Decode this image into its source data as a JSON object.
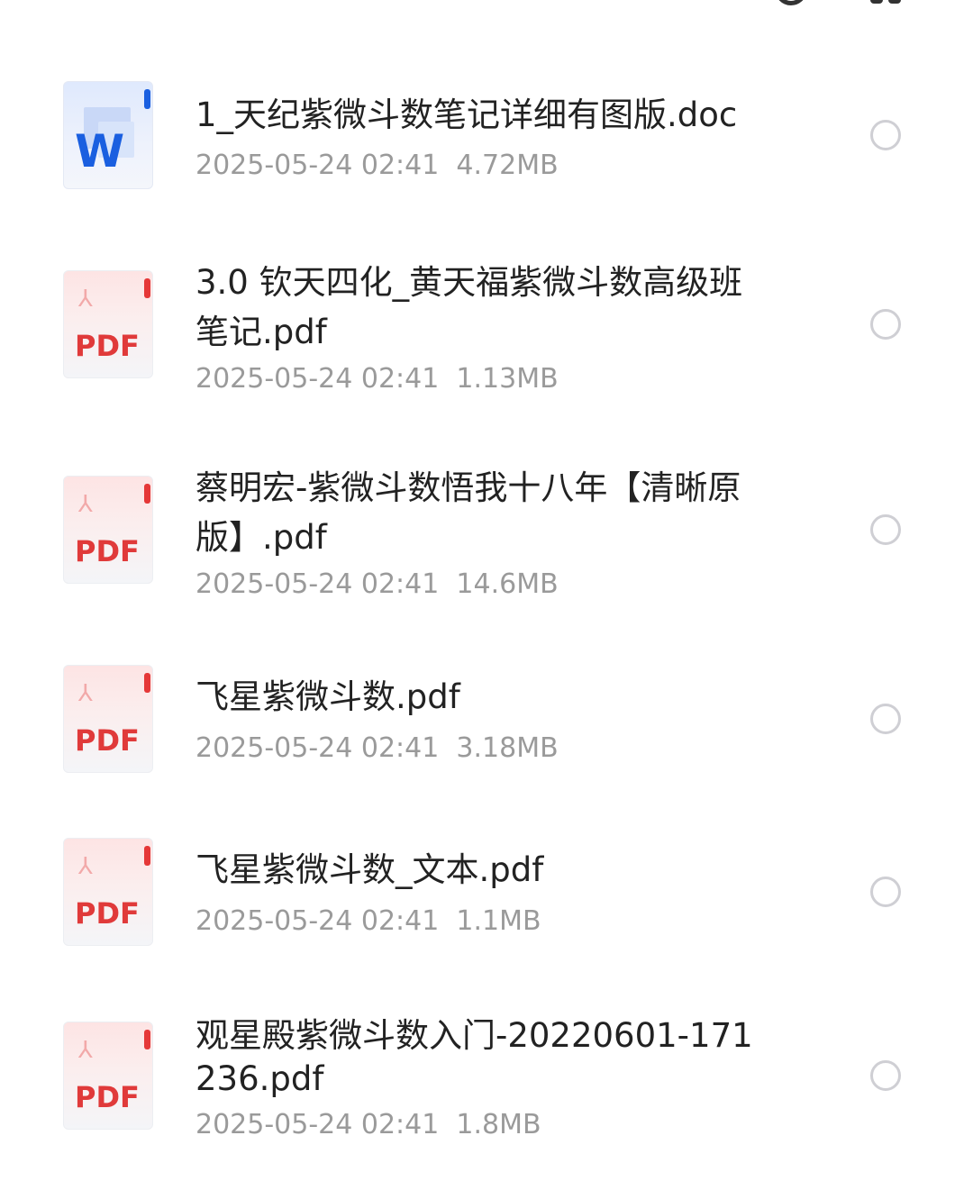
{
  "header": {
    "partial_label": ""
  },
  "files": [
    {
      "type": "doc",
      "name": "1_天纪紫微斗数笔记详细有图版.doc",
      "date": "2025-05-24 02:41",
      "size": "4.72MB",
      "icon_label": "W"
    },
    {
      "type": "pdf",
      "name": "3.0 钦天四化_黄天福紫微斗数高级班笔记.pdf",
      "date": "2025-05-24 02:41",
      "size": "1.13MB",
      "icon_label": "PDF"
    },
    {
      "type": "pdf",
      "name": "蔡明宏-紫微斗数悟我十八年【清晰原版】.pdf",
      "date": "2025-05-24 02:41",
      "size": "14.6MB",
      "icon_label": "PDF"
    },
    {
      "type": "pdf",
      "name": "飞星紫微斗数.pdf",
      "date": "2025-05-24 02:41",
      "size": "3.18MB",
      "icon_label": "PDF"
    },
    {
      "type": "pdf",
      "name": "飞星紫微斗数_文本.pdf",
      "date": "2025-05-24 02:41",
      "size": "1.1MB",
      "icon_label": "PDF"
    },
    {
      "type": "pdf",
      "name": "观星殿紫微斗数入门-20220601-171236.pdf",
      "date": "2025-05-24 02:41",
      "size": "1.8MB",
      "icon_label": "PDF"
    }
  ],
  "colors": {
    "pdf_accent": "#e03a3a",
    "doc_accent": "#1a5fe0",
    "meta_text": "#9a9a9a",
    "name_text": "#222222",
    "radio_border": "#cfcfd4"
  },
  "icons": {
    "search": "search-icon",
    "grid": "grid-view-icon",
    "pdf": "pdf-file-icon",
    "doc": "word-doc-icon",
    "select": "radio-unchecked-icon"
  }
}
